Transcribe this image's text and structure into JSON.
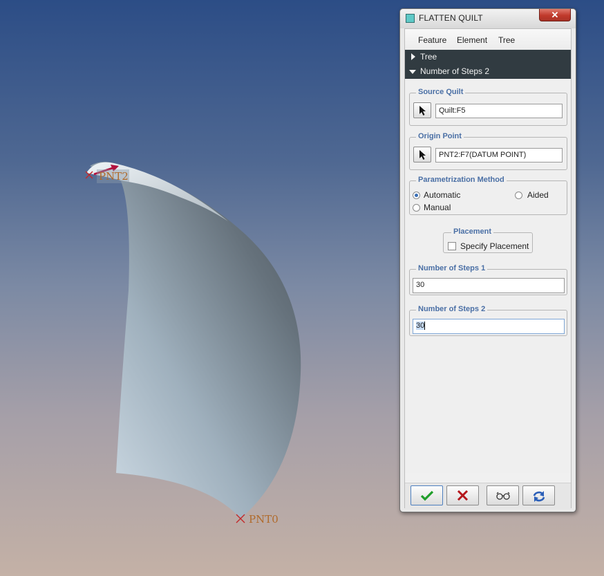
{
  "viewport": {
    "points": [
      {
        "label": "PNT2"
      },
      {
        "label": "PNT0"
      }
    ],
    "colors": {
      "point_marker": "#c2292b",
      "point_label": "#b06a2a",
      "direction_arrow": "#b3123f"
    }
  },
  "dialog": {
    "title": "FLATTEN QUILT",
    "close_icon": "close-icon",
    "menu": [
      "Feature",
      "Element",
      "Tree"
    ],
    "tree_rows": [
      {
        "label": "Tree",
        "expanded": false
      },
      {
        "label": "Number of Steps 2",
        "expanded": true
      }
    ],
    "source_quilt": {
      "legend": "Source Quilt",
      "value": "Quilt:F5"
    },
    "origin_point": {
      "legend": "Origin Point",
      "value": "PNT2:F7(DATUM POINT)"
    },
    "parametrization": {
      "legend": "Parametrization Method",
      "options": [
        {
          "label": "Automatic",
          "checked": true
        },
        {
          "label": "Aided",
          "checked": false
        },
        {
          "label": "Manual",
          "checked": false
        }
      ]
    },
    "placement": {
      "legend": "Placement",
      "checkbox_label": "Specify Placement",
      "checked": false
    },
    "steps1": {
      "legend": "Number of Steps 1",
      "value": "30"
    },
    "steps2": {
      "legend": "Number of Steps 2",
      "value": "30"
    },
    "footer_buttons": [
      {
        "name": "ok",
        "icon": "checkmark-icon",
        "color": "#1f9e2a"
      },
      {
        "name": "cancel",
        "icon": "x-icon",
        "color": "#b5161b"
      },
      {
        "name": "preview",
        "icon": "glasses-icon"
      },
      {
        "name": "repaint",
        "icon": "refresh-icon",
        "color": "#2b5fb8"
      }
    ]
  }
}
